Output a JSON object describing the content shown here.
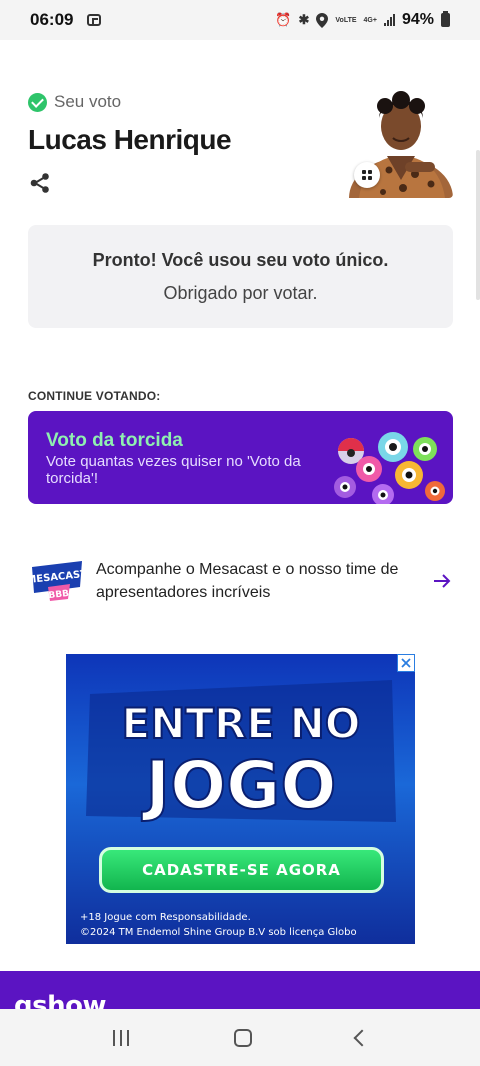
{
  "status_bar": {
    "time": "06:09",
    "battery_percent": "94%",
    "network_lte": "VoLTE",
    "network_4g": "4G+",
    "icons": [
      "screenshot-icon",
      "alarm-icon",
      "bluetooth-icon",
      "location-icon",
      "signal-icon",
      "battery-icon"
    ]
  },
  "vote": {
    "status_label": "Seu voto",
    "candidate_name": "Lucas Henrique"
  },
  "confirmation": {
    "title": "Pronto! Você usou seu voto único.",
    "subtitle": "Obrigado por votar."
  },
  "continue_section": {
    "label": "CONTINUE VOTANDO:",
    "card": {
      "title": "Voto da torcida",
      "description": "Vote quantas vezes quiser no 'Voto da torcida'!"
    }
  },
  "mesacast": {
    "logo_text": "MESACAST",
    "logo_sub": "BBB",
    "text": "Acompanhe o Mesacast e o nosso time de apresentadores incríveis"
  },
  "ad": {
    "headline_line1": "ENTRE NO",
    "headline_line2": "JOGO",
    "cta": "CADASTRE-SE AGORA",
    "disclaimer_line1": "+18 Jogue com Responsabilidade.",
    "disclaimer_line2": "©2024 TM Endemol Shine Group B.V sob licença Globo"
  },
  "footer": {
    "logo": "gshow"
  },
  "colors": {
    "purple": "#5b14c2",
    "green_check": "#2ec46a",
    "card_title_green": "#8ff0b0",
    "ad_blue": "#1a68d8",
    "cta_green": "#12b54e"
  }
}
